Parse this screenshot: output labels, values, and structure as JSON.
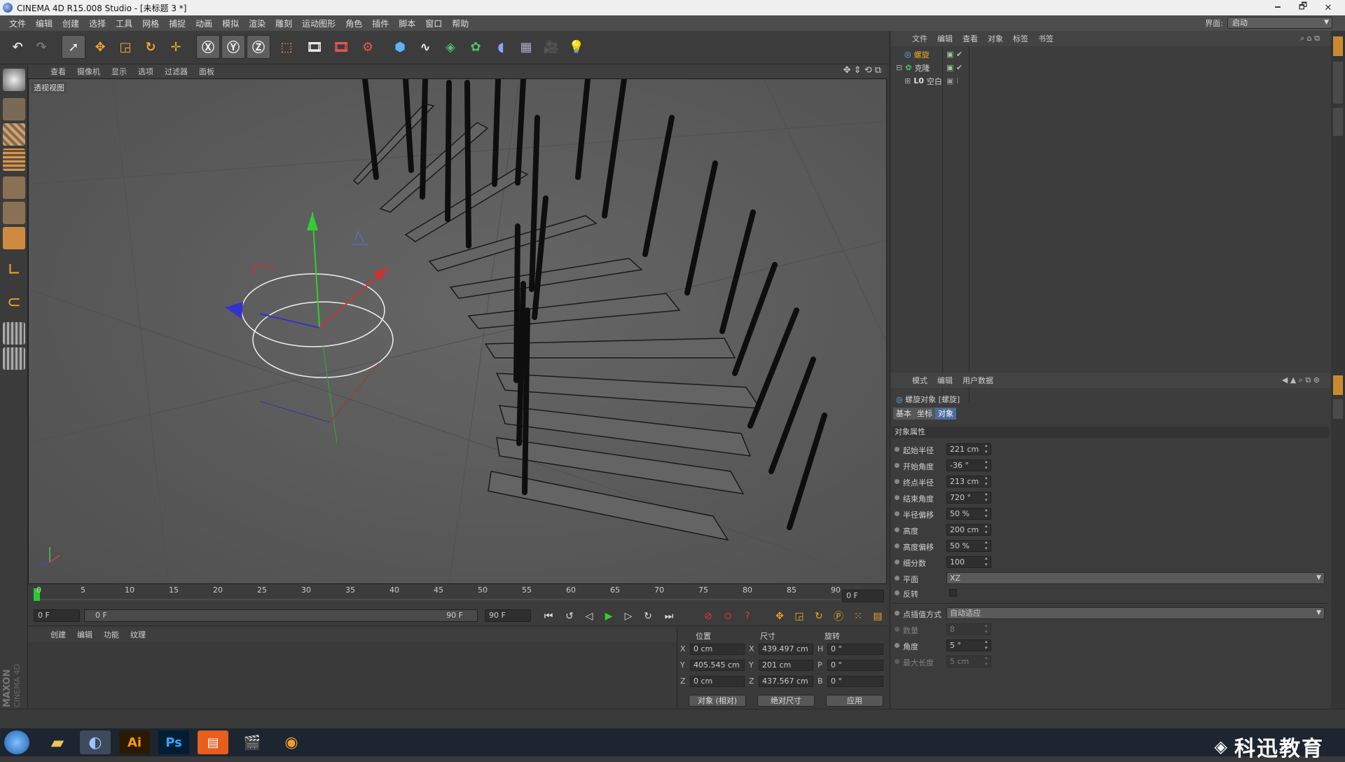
{
  "window": {
    "title": "CINEMA 4D R15.008 Studio - [未标题 3 *]",
    "controls": [
      "🗕",
      "🗗",
      "✕"
    ]
  },
  "menu": [
    "文件",
    "编辑",
    "创建",
    "选择",
    "工具",
    "网格",
    "捕捉",
    "动画",
    "模拟",
    "渲染",
    "雕刻",
    "运动图形",
    "角色",
    "插件",
    "脚本",
    "窗口",
    "帮助"
  ],
  "layout": {
    "label": "界面:",
    "value": "启动"
  },
  "viewport": {
    "menu": [
      "查看",
      "摄像机",
      "显示",
      "选项",
      "过滤器",
      "面板"
    ],
    "name": "透视视图"
  },
  "timeline": {
    "ticks": [
      "0",
      "5",
      "10",
      "15",
      "20",
      "25",
      "30",
      "35",
      "40",
      "45",
      "50",
      "55",
      "60",
      "65",
      "70",
      "75",
      "80",
      "85",
      "90"
    ],
    "end_frame": "0 F"
  },
  "transport": {
    "start": "0 F",
    "slider_start": "0 F",
    "slider_end": "90 F",
    "end": "90 F"
  },
  "material": {
    "menu": [
      "创建",
      "编辑",
      "功能",
      "纹理"
    ]
  },
  "coords": {
    "headers": [
      "位置",
      "尺寸",
      "旋转"
    ],
    "rows": [
      {
        "axis": "X",
        "pos": "0 cm",
        "size_axis": "X",
        "size": "439.497 cm",
        "rot_axis": "H",
        "rot": "0 °"
      },
      {
        "axis": "Y",
        "pos": "405.545 cm",
        "size_axis": "Y",
        "size": "201 cm",
        "rot_axis": "P",
        "rot": "0 °"
      },
      {
        "axis": "Z",
        "pos": "0 cm",
        "size_axis": "Z",
        "size": "437.567 cm",
        "rot_axis": "B",
        "rot": "0 °"
      }
    ],
    "mode": "对象 (相对)",
    "size_mode": "绝对尺寸",
    "apply": "应用"
  },
  "objects": {
    "menu": [
      "文件",
      "编辑",
      "查看",
      "对象",
      "标签",
      "书签"
    ],
    "items": [
      {
        "name": "螺旋"
      },
      {
        "name": "克隆"
      },
      {
        "name": "空白"
      }
    ]
  },
  "attributes": {
    "menu": [
      "模式",
      "编辑",
      "用户数据"
    ],
    "title": "螺旋对象 [螺旋]",
    "tabs": [
      "基本",
      "坐标",
      "对象"
    ],
    "section": "对象属性",
    "fields": [
      {
        "label": "起始半径",
        "value": "221 cm"
      },
      {
        "label": "开始角度",
        "value": "-36 °"
      },
      {
        "label": "终点半径",
        "value": "213 cm"
      },
      {
        "label": "结束角度",
        "value": "720 °"
      },
      {
        "label": "半径偏移",
        "value": "50 %"
      },
      {
        "label": "高度",
        "value": "200 cm"
      },
      {
        "label": "高度偏移",
        "value": "50 %"
      },
      {
        "label": "细分数",
        "value": "100"
      }
    ],
    "plane": {
      "label": "平面",
      "value": "XZ"
    },
    "reverse": {
      "label": "反转"
    },
    "interp": {
      "label": "点插值方式",
      "value": "自动适应"
    },
    "disabled": [
      {
        "label": "数量",
        "value": "8"
      },
      {
        "label": "角度",
        "value": "5 °"
      },
      {
        "label": "最大长度",
        "value": "5 cm"
      }
    ]
  },
  "watermark": "科迅教育",
  "brand": "MAXON CINEMA 4D"
}
